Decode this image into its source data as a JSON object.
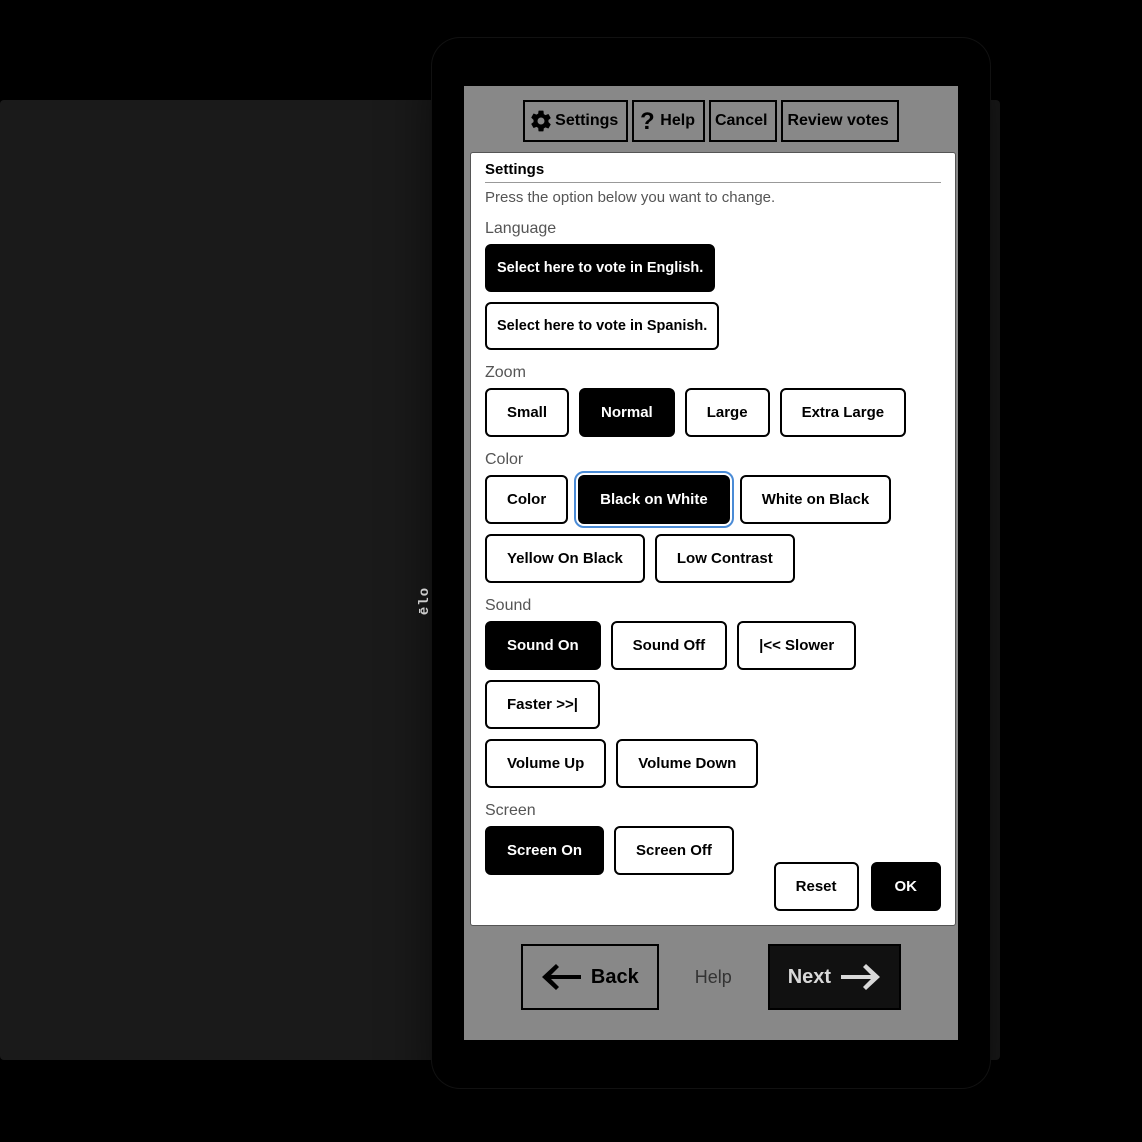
{
  "toolbar": {
    "settings": "Settings",
    "help": "Help",
    "cancel": "Cancel",
    "review": "Review votes"
  },
  "bottom": {
    "back": "Back",
    "help": "Help",
    "next": "Next"
  },
  "modal": {
    "title": "Settings",
    "subtitle": "Press the option below you want to change.",
    "language": {
      "label": "Language",
      "english": "Select here to vote in English.",
      "spanish": "Select here to vote in Spanish."
    },
    "zoom": {
      "label": "Zoom",
      "small": "Small",
      "normal": "Normal",
      "large": "Large",
      "extra": "Extra Large"
    },
    "color": {
      "label": "Color",
      "color": "Color",
      "bw": "Black on White",
      "wb": "White on Black",
      "yb": "Yellow On Black",
      "low": "Low Contrast"
    },
    "sound": {
      "label": "Sound",
      "on": "Sound On",
      "off": "Sound Off",
      "slower": "|<< Slower",
      "faster": "Faster >>|",
      "volup": "Volume Up",
      "voldown": "Volume Down"
    },
    "screen": {
      "label": "Screen",
      "on": "Screen On",
      "off": "Screen Off"
    },
    "footer": {
      "reset": "Reset",
      "ok": "OK"
    }
  },
  "device": {
    "brand": "ēlo"
  }
}
